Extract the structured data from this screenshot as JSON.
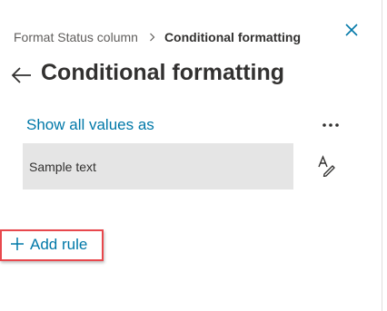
{
  "breadcrumb": {
    "parent": "Format Status column",
    "current": "Conditional formatting"
  },
  "header": {
    "title": "Conditional formatting",
    "back_icon": "arrow-left-icon",
    "close_icon": "close-icon"
  },
  "main": {
    "show_all_label": "Show all values as",
    "more_icon": "more-horizontal-icon",
    "sample_text": "Sample text",
    "format_icon": "text-format-pen-icon",
    "add_rule_label": "Add rule",
    "add_rule_icon": "plus-icon"
  },
  "colors": {
    "accent": "#0078a8",
    "highlight_border": "#e8484d",
    "sample_bg": "#e5e5e5",
    "text": "#323130"
  }
}
